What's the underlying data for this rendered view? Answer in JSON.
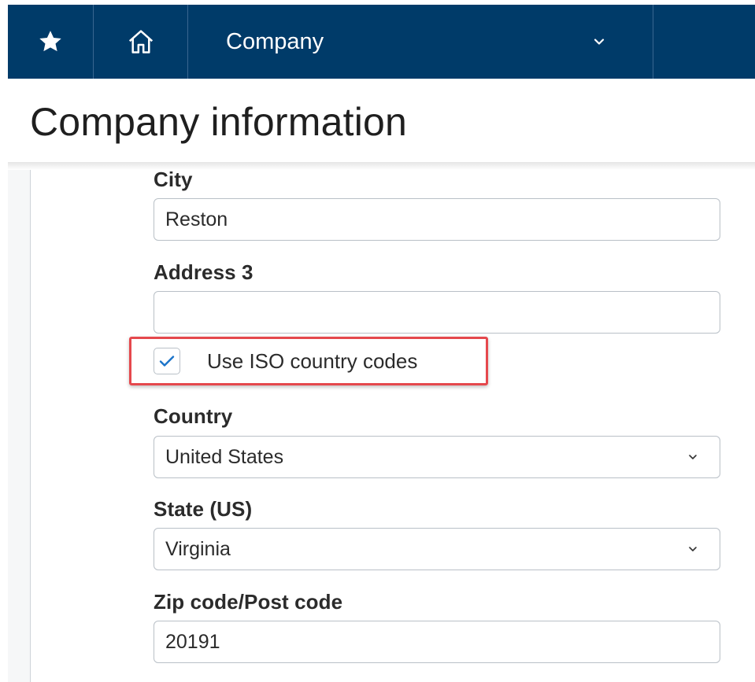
{
  "nav": {
    "favorites_icon": "star-icon",
    "home_icon": "home-icon",
    "module_label": "Company",
    "module_dropdown_icon": "chevron-down-icon",
    "bar_color": "#003b69"
  },
  "page": {
    "title": "Company information"
  },
  "form": {
    "city": {
      "label": "City",
      "value": "Reston"
    },
    "address3": {
      "label": "Address 3",
      "value": ""
    },
    "iso_codes": {
      "label": "Use ISO country codes",
      "checked": true,
      "check_color": "#1a73c9",
      "highlight_color": "#e5484d"
    },
    "country": {
      "label": "Country",
      "value": "United States"
    },
    "state": {
      "label": "State (US)",
      "value": "Virginia"
    },
    "zip": {
      "label": "Zip code/Post code",
      "value": "20191"
    }
  }
}
